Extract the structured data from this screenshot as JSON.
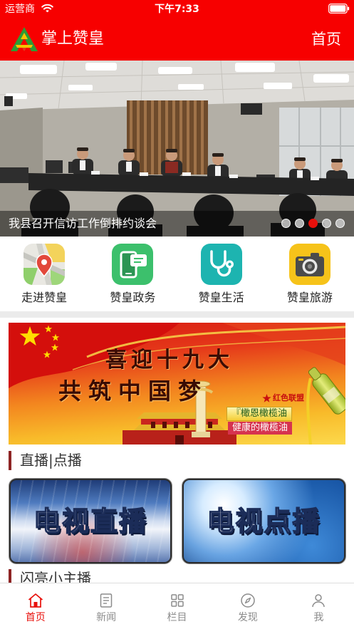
{
  "status_bar": {
    "carrier": "运营商",
    "time": "下午7:33",
    "wifi_icon": "wifi-icon",
    "battery_icon": "battery-icon"
  },
  "header": {
    "logo_icon": "app-logo-icon",
    "title": "掌上赞皇",
    "home_link": "首页"
  },
  "carousel": {
    "caption": "我县召开信访工作倒排约谈会",
    "slide_count": 5,
    "active_index": 2
  },
  "quick_links": [
    {
      "label": "走进赞皇",
      "icon": "map-icon"
    },
    {
      "label": "赞皇政务",
      "icon": "phone-chat-icon"
    },
    {
      "label": "赞皇生活",
      "icon": "stethoscope-icon"
    },
    {
      "label": "赞皇旅游",
      "icon": "camera-icon"
    }
  ],
  "ad_banner": {
    "slogan_line1": "喜迎十九大",
    "slogan_line2": "共筑中国梦",
    "brand": "红色联盟",
    "product": "『橄恩橄榄油",
    "tagline": "健康的橄榄油"
  },
  "sections": [
    {
      "title": "直播|点播",
      "cards": [
        {
          "label": "电视直播"
        },
        {
          "label": "电视点播"
        }
      ]
    },
    {
      "title": "闪亮小主播"
    }
  ],
  "tab_bar": {
    "items": [
      {
        "label": "首页",
        "icon": "home-icon",
        "active": true
      },
      {
        "label": "新闻",
        "icon": "news-icon",
        "active": false
      },
      {
        "label": "栏目",
        "icon": "grid-icon",
        "active": false
      },
      {
        "label": "发现",
        "icon": "compass-icon",
        "active": false
      },
      {
        "label": "我",
        "icon": "person-icon",
        "active": false
      }
    ]
  },
  "colors": {
    "brand_red": "#f70000",
    "section_marker": "#8e2424",
    "tab_active": "#e8100b",
    "tab_inactive": "#8c8c8c",
    "active_dot": "#e8100b"
  }
}
